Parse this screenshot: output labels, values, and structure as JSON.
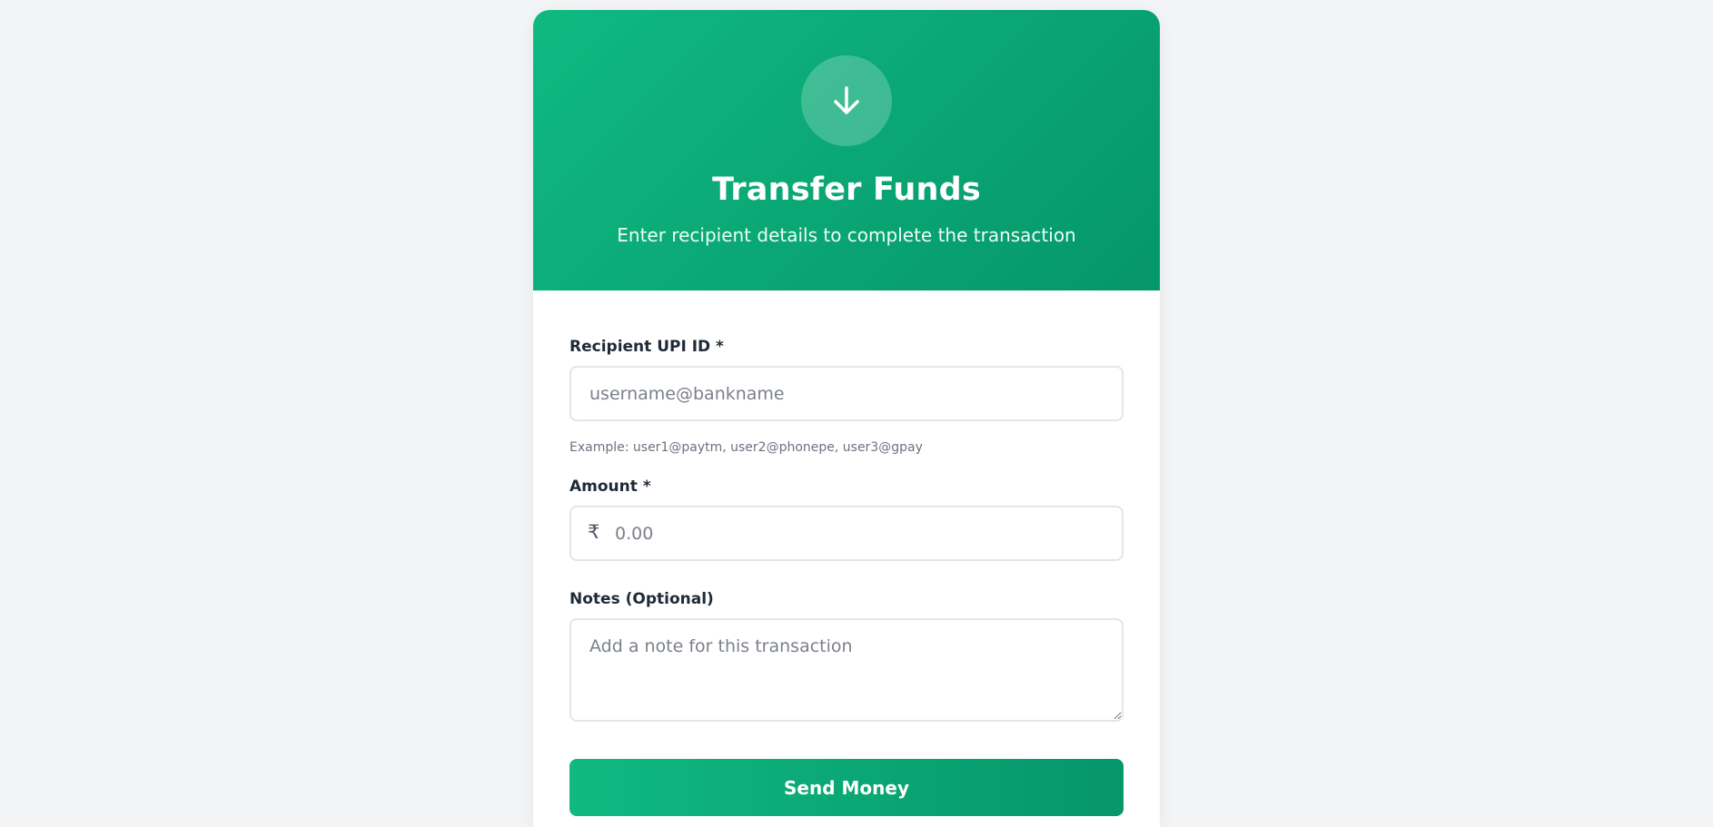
{
  "header": {
    "icon": "arrow-down-icon",
    "title": "Transfer Funds",
    "subtitle": "Enter recipient details to complete the transaction"
  },
  "form": {
    "upi": {
      "label": "Recipient UPI ID *",
      "placeholder": "username@bankname",
      "value": "",
      "hint": "Example: user1@paytm, user2@phonepe, user3@gpay"
    },
    "amount": {
      "label": "Amount *",
      "currency_symbol": "₹",
      "placeholder": "0.00",
      "value": ""
    },
    "notes": {
      "label": "Notes (Optional)",
      "placeholder": "Add a note for this transaction",
      "value": ""
    },
    "submit_label": "Send Money"
  },
  "colors": {
    "accent": "#10b981",
    "accent_dark": "#059669",
    "background": "#f2f4f6"
  }
}
